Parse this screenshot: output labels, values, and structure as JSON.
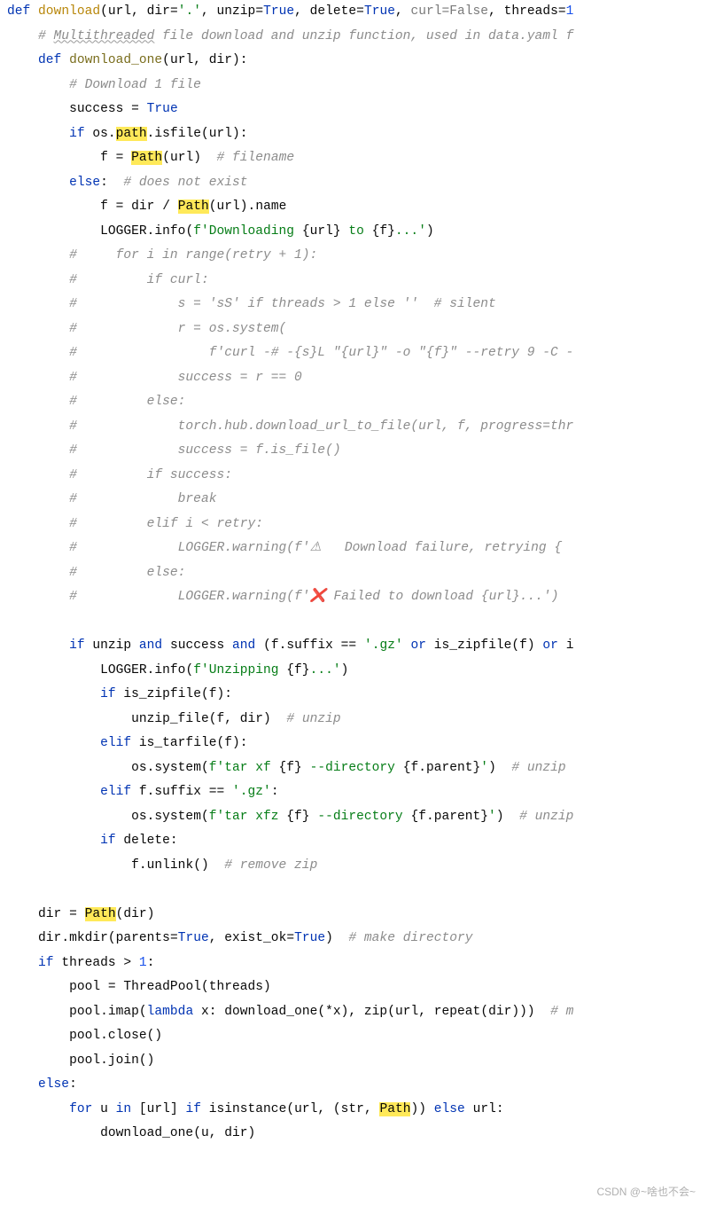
{
  "func_sig": {
    "def": "def",
    "name": "download",
    "p_url": "url",
    "p_dir": "dir",
    "eq1": "=",
    "v_dir": "'.'",
    "p_unzip": "unzip",
    "eq2": "=",
    "v_true": "True",
    "p_delete": "delete",
    "eq3": "=",
    "p_curl": "curl",
    "eq4": "=",
    "v_false": "False",
    "p_threads": "threads",
    "eq5": "=",
    "v_one": "1"
  },
  "comments": {
    "c1": "# ",
    "c1_u": "Multithreaded",
    "c1_r": " file download and unzip function, used in data.yaml f",
    "c2": "# Download 1 file",
    "c3": "# filename",
    "c4": "# does not exist",
    "c_for": "#     for i in range(retry + 1):",
    "c_ifcurl": "#         if curl:",
    "c_s": "#             s = 'sS' if threads > 1 else ''  # silent",
    "c_r": "#             r = os.system(",
    "c_curl": "#                 f'curl -# -{s}L \"{url}\" -o \"{f}\" --retry 9 -C -",
    "c_succ": "#             success = r == 0",
    "c_else": "#         else:",
    "c_torch": "#             torch.hub.download_url_to_file(url, f, progress=thr",
    "c_succ2": "#             success = f.is_file()",
    "c_ifsucc": "#         if success:",
    "c_break": "#             break",
    "c_elif": "#         elif i < retry:",
    "c_warn": "#             LOGGER.warning(f'⚠   Download failure, retrying {",
    "c_else2": "#         else:",
    "c_warn2": "#             LOGGER.warning(f'❌ Failed to download {url}...')",
    "c_unzip": "# unzip",
    "c_unzip2": "# unzip",
    "c_unzip3": "# unzip",
    "c_rmzip": "# remove zip",
    "c_mkdir": "# make directory",
    "c_multi": "# m"
  },
  "code": {
    "def2": "def",
    "download_one": "download_one",
    "url": "url",
    "dir": "dir",
    "success": "success",
    "eq": "=",
    "true": "True",
    "if": "if",
    "os": "os",
    "path": "path",
    "isfile": "isfile",
    "f": "f",
    "Path": "Path",
    "else": "else",
    "name": "name",
    "logger": "LOGGER",
    "info": "info",
    "fstr_dl": "f'",
    "str_dl": "Downloading ",
    "brace_url": "{url}",
    "str_to": " to ",
    "brace_f": "{f}",
    "str_dots": "...'",
    "unzip": "unzip",
    "and": "and",
    "suffix": "suffix",
    "eqeq": "==",
    "gz": "'.gz'",
    "or": "or",
    "is_zipfile": "is_zipfile",
    "is_i": "i",
    "str_unzip": "Unzipping ",
    "unzip_file": "unzip_file",
    "elif": "elif",
    "is_tarfile": "is_tarfile",
    "system": "system",
    "tar1": "tar xf ",
    "dir_opt": " --directory ",
    "parent": "parent",
    "tar2": "tar xfz ",
    "delete": "delete",
    "unlink": "unlink",
    "mkdir": "mkdir",
    "parents": "parents",
    "exist_ok": "exist_ok",
    "threads": "threads",
    "gt": ">",
    "one": "1",
    "pool": "pool",
    "ThreadPool": "ThreadPool",
    "imap": "imap",
    "lambda": "lambda",
    "x": "x",
    "star": "*",
    "zip": "zip",
    "repeat": "repeat",
    "close": "close",
    "join": "join",
    "for": "for",
    "u": "u",
    "in": "in",
    "isinstance": "isinstance",
    "str_t": "str",
    "quote": "'"
  },
  "watermark": "CSDN @~啥也不会~"
}
